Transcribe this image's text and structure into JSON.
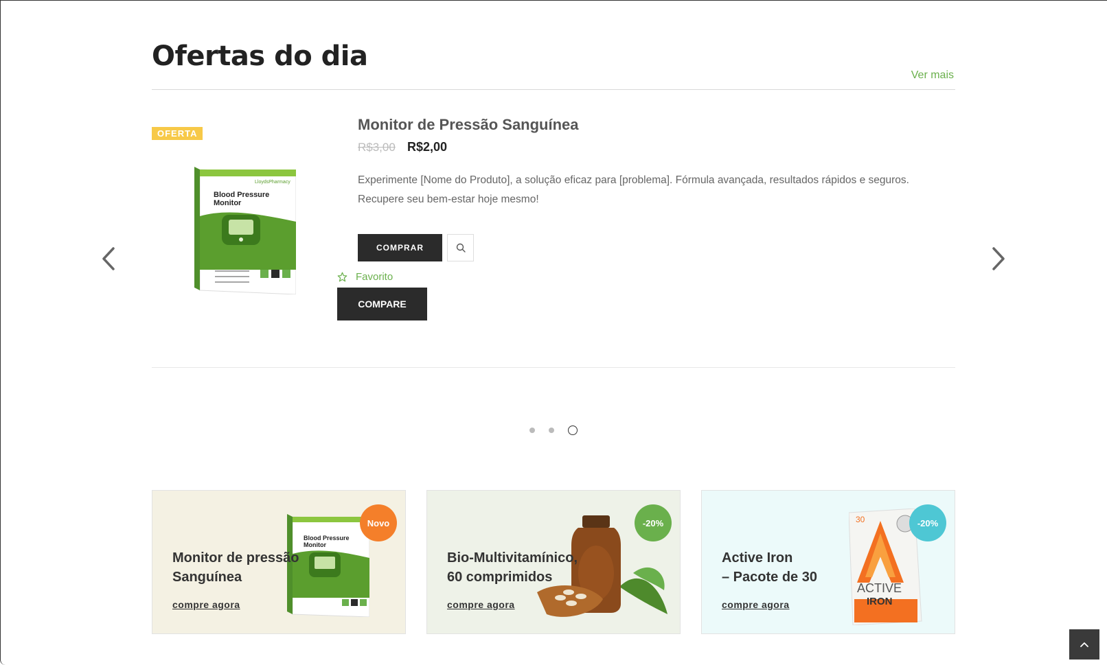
{
  "section": {
    "title": "Ofertas do dia",
    "more_link": "Ver mais"
  },
  "featured": {
    "badge": "OFERTA",
    "name": "Monitor de Pressão Sanguínea",
    "price_old": "R$3,00",
    "price_new": "R$2,00",
    "description": "Experimente [Nome do Produto], a solução eficaz para [problema]. Fórmula avançada, resultados rápidos e seguros. Recupere seu bem-estar hoje mesmo!",
    "buy_label": "COMPRAR",
    "favorite_label": "Favorito",
    "compare_label": "COMPARE",
    "box_brand": "LloydsPharmacy",
    "box_title_line1": "Blood Pressure",
    "box_title_line2": "Monitor",
    "accent": "#6ab04c"
  },
  "carousel": {
    "dots": 3,
    "active_dot": 3
  },
  "cards": [
    {
      "title_line1": "Monitor de pressão",
      "title_line2": "Sanguínea",
      "link": "compre agora",
      "badge": "Novo",
      "badge_color": "#f47f2a",
      "bg": "#f4f1e3"
    },
    {
      "title_line1": "Bio-Multivitamínico,",
      "title_line2": "60 comprimidos",
      "link": "compre agora",
      "badge": "-20%",
      "badge_color": "#6ab04c",
      "bg": "#eef2e8"
    },
    {
      "title_line1": "Active Iron",
      "title_line2": "– Pacote de 30",
      "link": "compre agora",
      "badge": "-20%",
      "badge_color": "#4ec7d4",
      "bg": "#ecfafa",
      "box_number": "30",
      "box_word1": "ACTIVE",
      "box_word2": "IRON"
    }
  ],
  "icons": {
    "prev": "chevron-left-icon",
    "next": "chevron-right-icon",
    "search": "search-icon",
    "favorite": "star-outline-icon",
    "back_to_top": "chevron-up-icon"
  }
}
